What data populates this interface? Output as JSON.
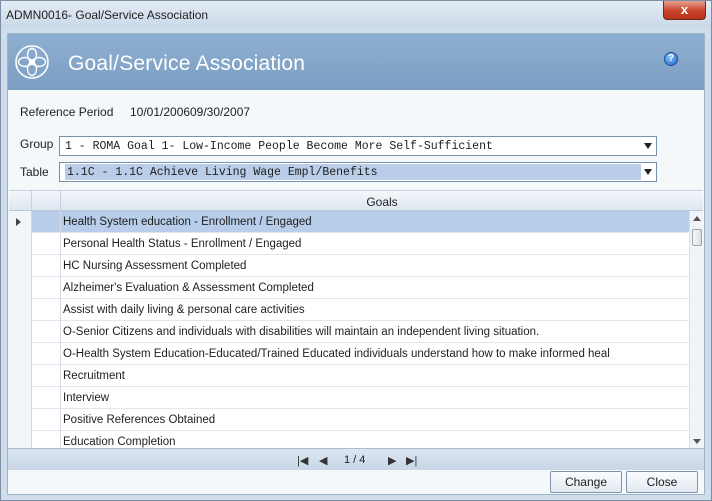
{
  "window": {
    "title": "ADMN0016- Goal/Service Association",
    "close_label": "x"
  },
  "header": {
    "title": "Goal/Service Association",
    "help_label": "?"
  },
  "reference": {
    "label": "Reference Period",
    "start": "10/01/2006",
    "end": "09/30/2007"
  },
  "group": {
    "label": "Group",
    "value": "1 - ROMA Goal 1- Low-Income People Become More Self-Sufficient"
  },
  "table": {
    "label": "Table",
    "value": "1.1C - 1.1C Achieve Living Wage Empl/Benefits"
  },
  "grid": {
    "column_header": "Goals",
    "rows": [
      "Health System education - Enrollment / Engaged",
      "Personal Health Status - Enrollment / Engaged",
      "HC Nursing Assessment Completed",
      "Alzheimer's Evaluation & Assessment Completed",
      "Assist with daily living & personal care activities",
      "O-Senior Citizens and individuals with disabilities will maintain an independent living situation.",
      "O-Health System Education-Educated/Trained Educated individuals understand how to make informed heal",
      "Recruitment",
      "Interview",
      "Positive References Obtained",
      "Education Completion"
    ],
    "selected_index": 0
  },
  "pager": {
    "first": "|◀",
    "prev": "◀",
    "page_text": "1 / 4",
    "next": "▶",
    "last": "▶|"
  },
  "buttons": {
    "change": "Change",
    "close": "Close"
  },
  "colors": {
    "header_bg": "#7b9ec3",
    "selected_row": "#b8cde9",
    "close_red": "#c9442c"
  }
}
